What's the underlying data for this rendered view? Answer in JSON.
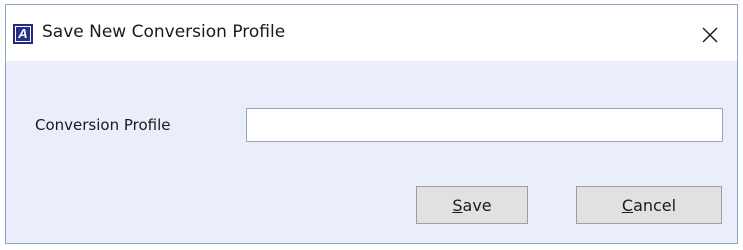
{
  "window": {
    "title": "Save New Conversion Profile",
    "icon": "app-a-icon",
    "icon_letter": "A",
    "close_icon": "close-icon"
  },
  "form": {
    "label": "Conversion Profile",
    "value": "",
    "placeholder": ""
  },
  "buttons": {
    "save": {
      "mnemonic": "S",
      "rest": "ave"
    },
    "cancel": {
      "mnemonic": "C",
      "rest": "ancel"
    }
  },
  "colors": {
    "dialog_background": "#e9eefa",
    "titlebar_background": "#ffffff",
    "icon_blue": "#23318c",
    "button_face": "#e1e1e1"
  }
}
